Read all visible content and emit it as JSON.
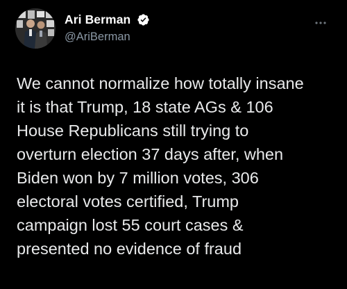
{
  "theme": {
    "background": "#000000",
    "text": "#e9eaeb",
    "secondary_text": "#8b98a5",
    "verified_badge": "#ffffff"
  },
  "author": {
    "display_name": "Ari Berman",
    "handle": "@AriBerman",
    "verified": true,
    "avatar_icon": "profile-photo"
  },
  "menu": {
    "icon": "more-horizontal-icon"
  },
  "tweet": {
    "lines": [
      "We cannot normalize how totally insane",
      "it is that Trump, 18 state AGs & 106",
      "House Republicans still trying to",
      "overturn election 37 days after, when",
      "Biden won by 7 million votes, 306",
      "electoral votes certified, Trump",
      "campaign lost 55 court cases &",
      "presented no evidence of fraud"
    ]
  }
}
